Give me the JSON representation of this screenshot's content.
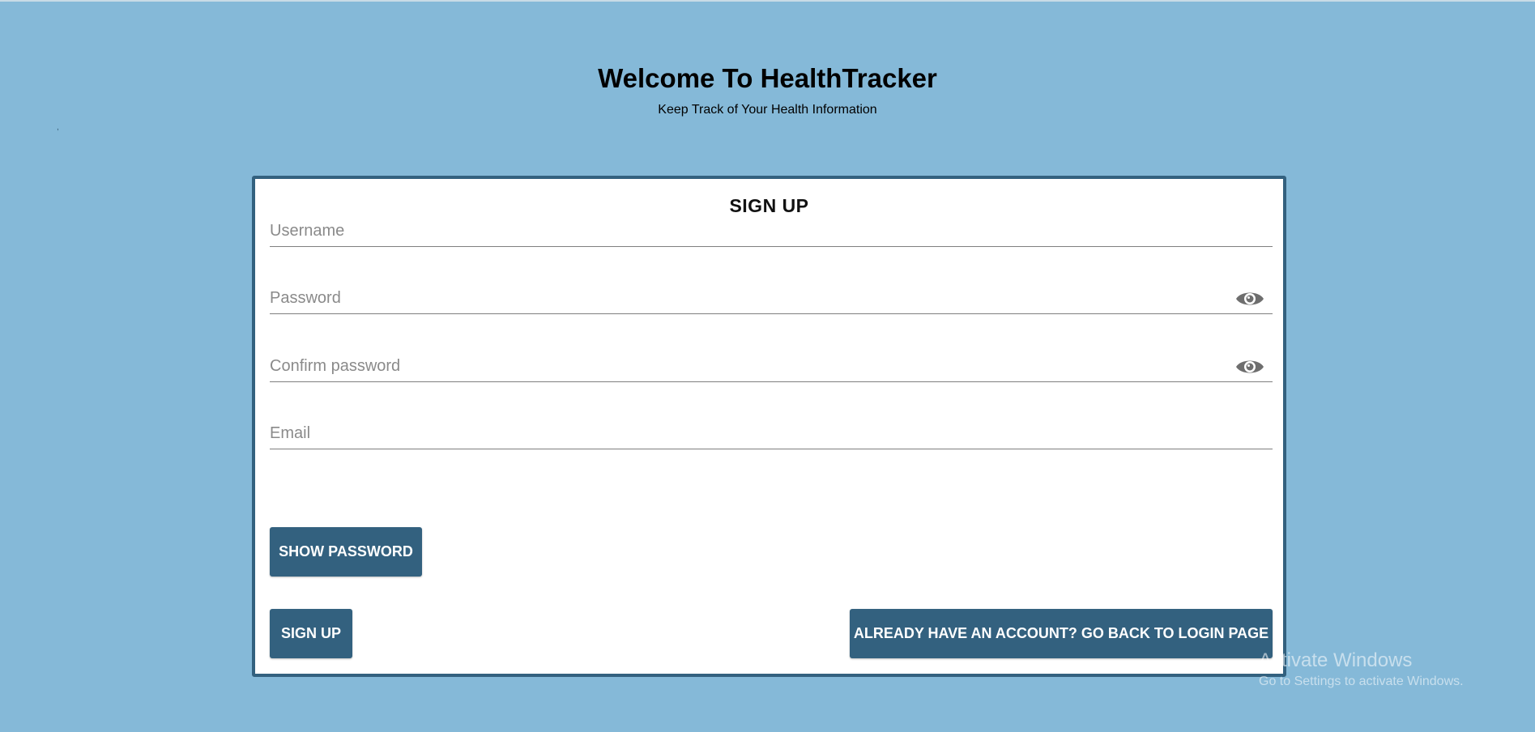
{
  "header": {
    "title": "Welcome To HealthTracker",
    "subtitle": "Keep Track of Your Health Information"
  },
  "stray_mark": ",",
  "form": {
    "title": "SIGN UP",
    "fields": {
      "username": {
        "placeholder": "Username",
        "value": ""
      },
      "password": {
        "placeholder": "Password",
        "value": ""
      },
      "confirm_password": {
        "placeholder": "Confirm password",
        "value": ""
      },
      "email": {
        "placeholder": "Email",
        "value": ""
      }
    },
    "icons": {
      "password_toggle": "eye-icon",
      "confirm_toggle": "eye-icon"
    },
    "buttons": {
      "show_password": "SHOW PASSWORD",
      "sign_up": "SIGN UP",
      "back_to_login": "ALREADY HAVE AN ACCOUNT? GO BACK TO LOGIN PAGE"
    }
  },
  "watermark": {
    "line1": "Activate Windows",
    "line2": "Go to Settings to activate Windows."
  },
  "colors": {
    "background": "#85b9d8",
    "accent": "#33617f",
    "card": "#ffffff"
  }
}
